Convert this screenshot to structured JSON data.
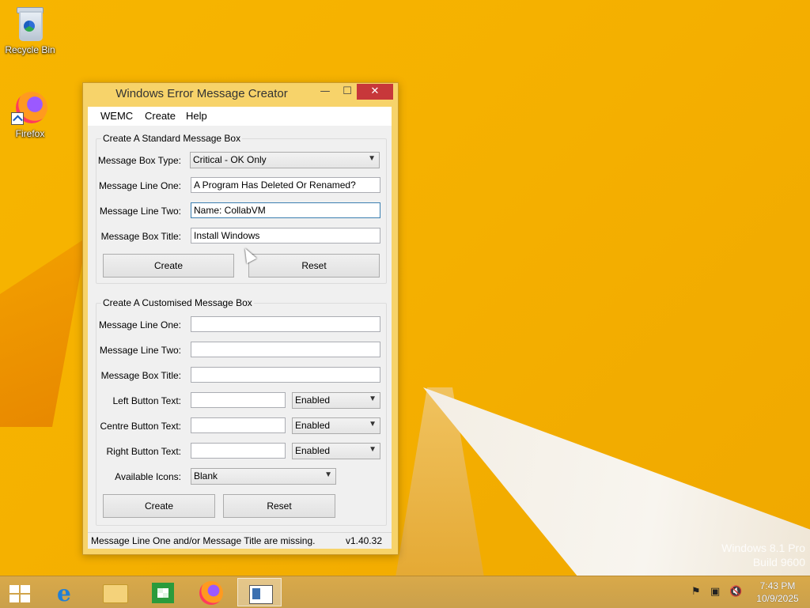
{
  "desktop": {
    "icons": [
      {
        "label": "Recycle Bin"
      },
      {
        "label": "Firefox"
      }
    ],
    "watermark": {
      "line1": "Windows 8.1 Pro",
      "line2": "Build 9600"
    }
  },
  "window": {
    "title": "Windows Error Message Creator",
    "controls": {
      "minimize": "—",
      "maximize": "☐",
      "close": "✕"
    },
    "menu": [
      "WEMC",
      "Create",
      "Help"
    ],
    "standard": {
      "group_label": "Create A Standard Message Box",
      "type_label": "Message Box Type:",
      "type_value": "Critical - OK Only",
      "line_one_label": "Message Line One:",
      "line_one_value": "A Program Has Deleted Or Renamed?",
      "line_two_label": "Message Line Two:",
      "line_two_value": "Name: CollabVM",
      "title_label": "Message Box Title:",
      "title_value": "Install Windows",
      "create_label": "Create",
      "reset_label": "Reset"
    },
    "custom": {
      "group_label": "Create A Customised Message Box",
      "line_one_label": "Message Line One:",
      "line_one_value": "",
      "line_two_label": "Message Line Two:",
      "line_two_value": "",
      "title_label": "Message Box Title:",
      "title_value": "",
      "left_button_label": "Left Button Text:",
      "left_button_state": "Enabled",
      "centre_button_label": "Centre Button Text:",
      "centre_button_state": "Enabled",
      "right_button_label": "Right Button Text:",
      "right_button_state": "Enabled",
      "icons_label": "Available Icons:",
      "icons_value": "Blank",
      "create_label": "Create",
      "reset_label": "Reset"
    },
    "status": {
      "message": "Message Line One and/or Message Title are missing.",
      "version": "v1.40.32"
    }
  },
  "taskbar": {
    "apps": [
      "start",
      "internet-explorer",
      "file-explorer",
      "store",
      "firefox",
      "wemc"
    ],
    "active_app": "wemc",
    "clock": {
      "time": "7:43 PM",
      "date": "10/9/2025"
    }
  }
}
